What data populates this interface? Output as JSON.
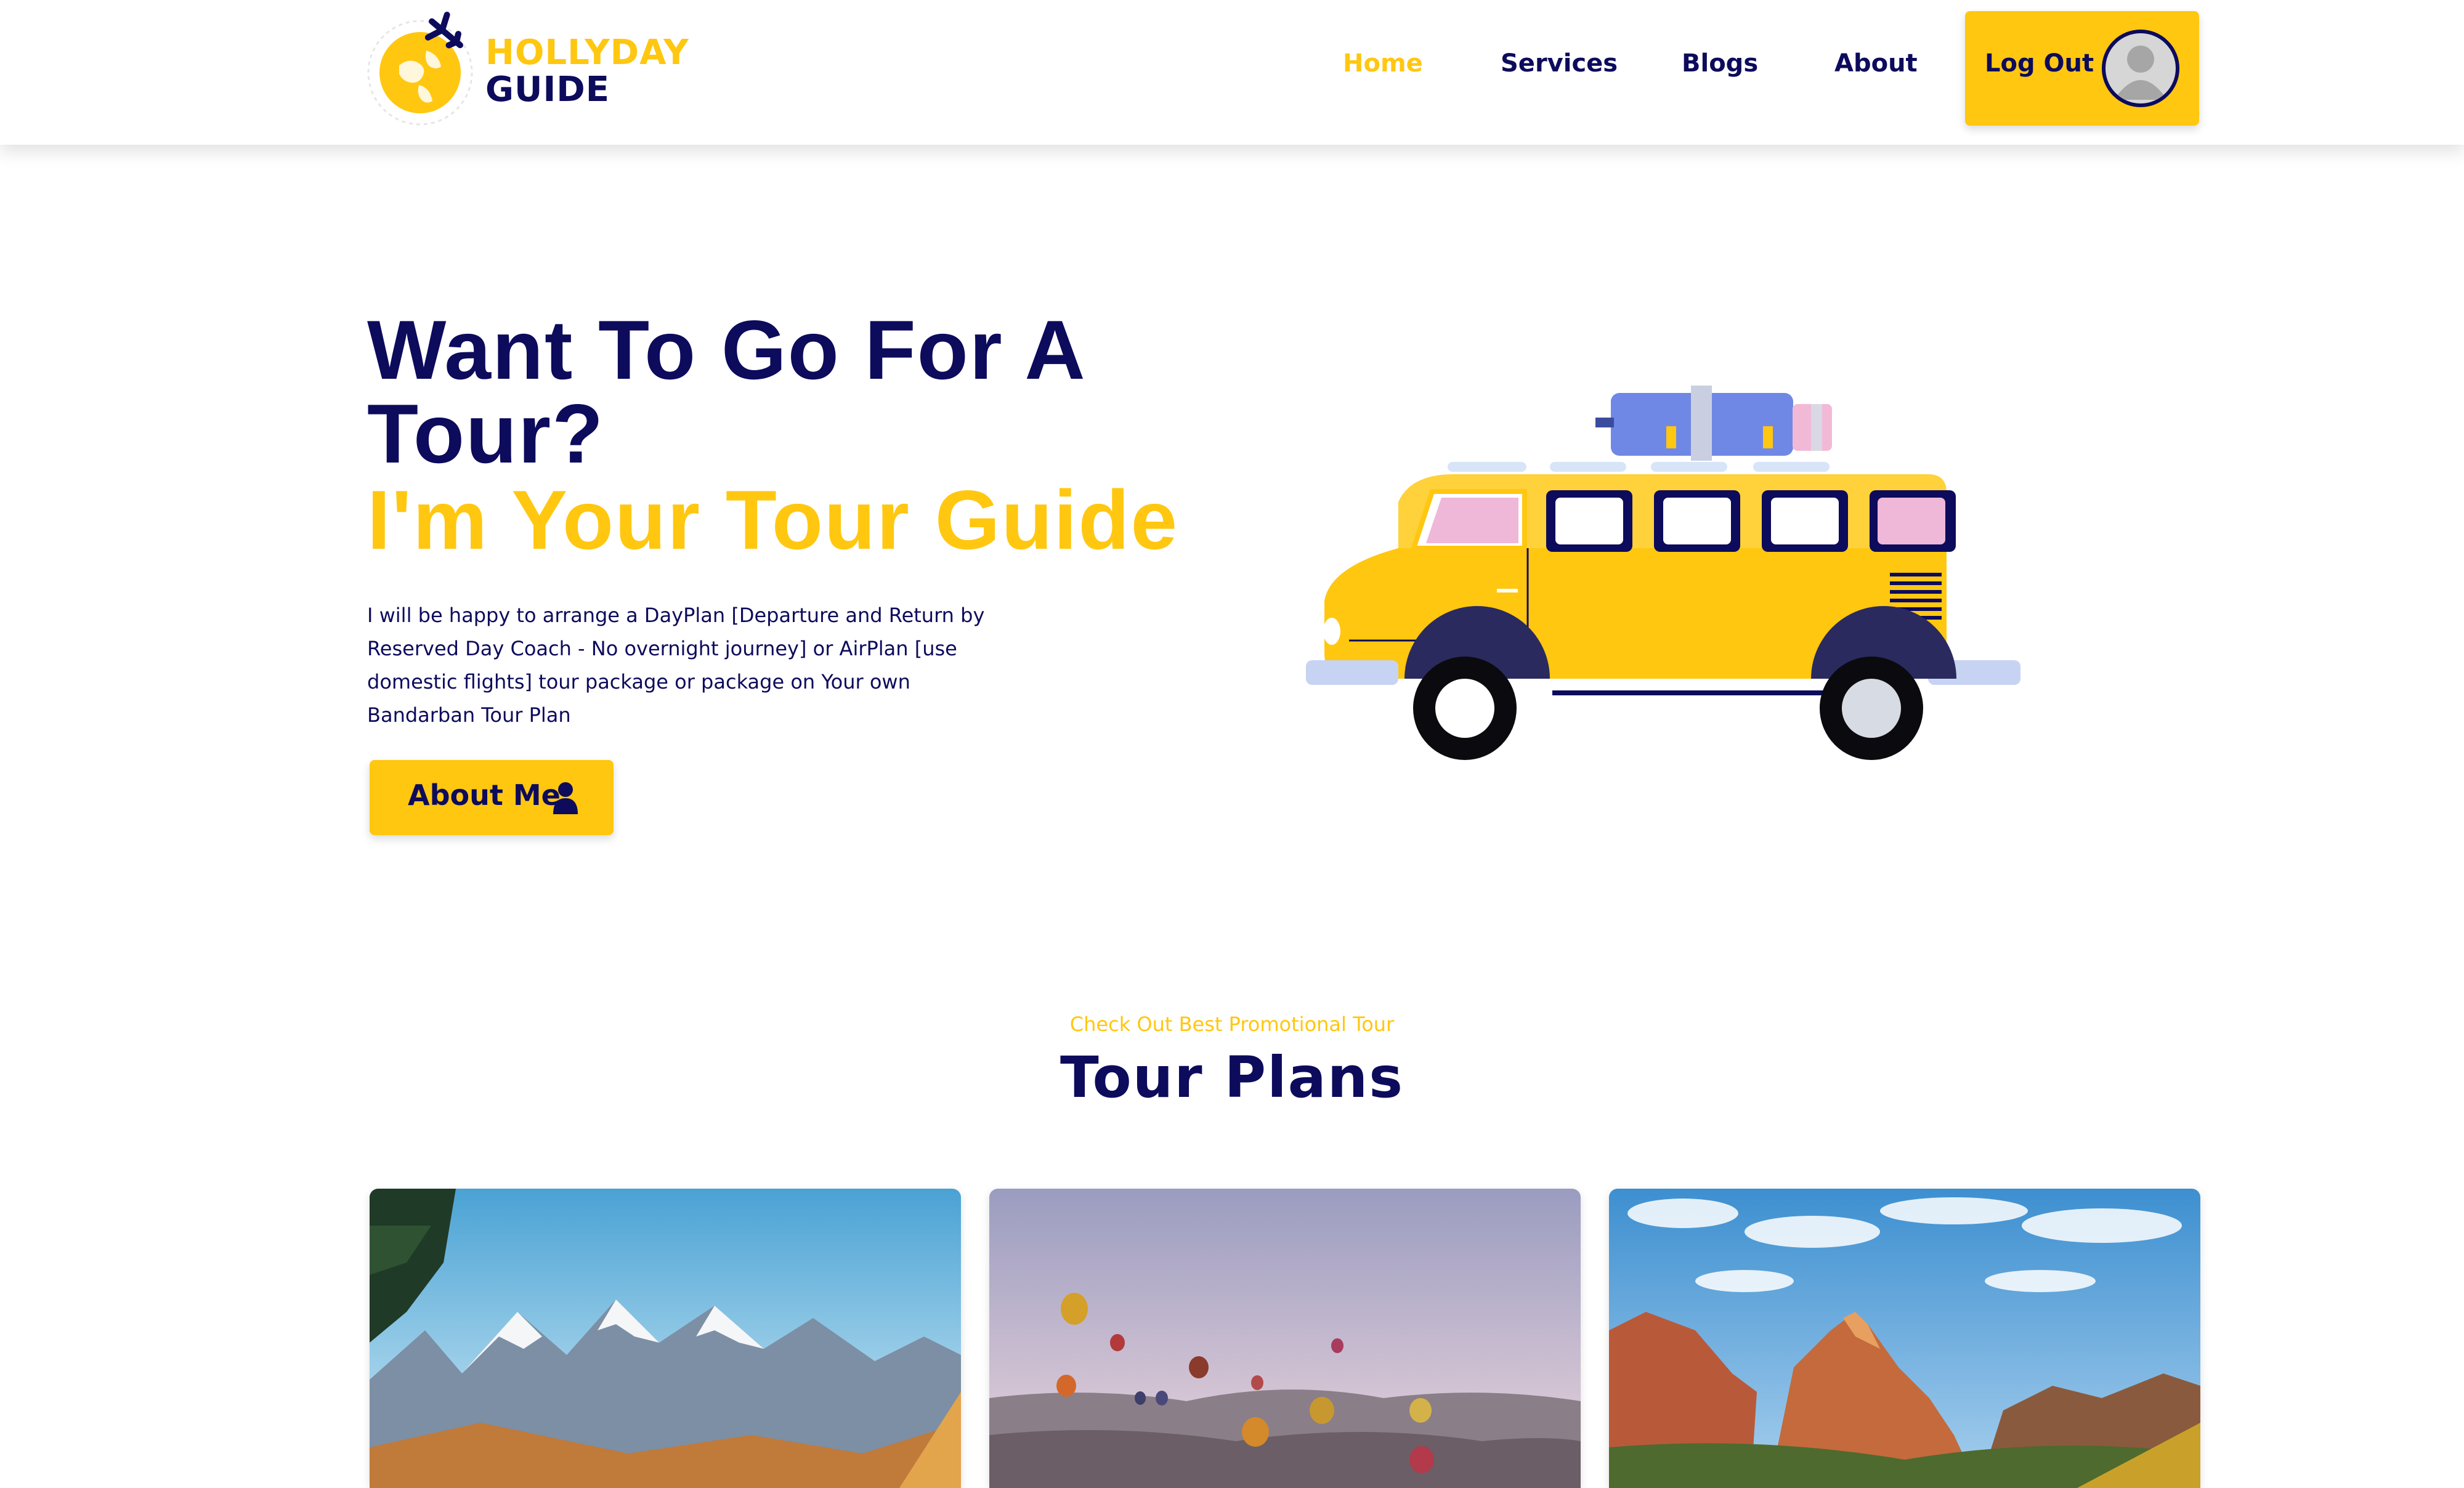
{
  "brand": {
    "line1": "HOLLYDAY",
    "line2": "GUIDE",
    "icon": "globe-plane-icon"
  },
  "nav": {
    "items": [
      {
        "label": "Home",
        "active": true
      },
      {
        "label": "Services",
        "active": false
      },
      {
        "label": "Blogs",
        "active": false
      },
      {
        "label": "About",
        "active": false
      }
    ],
    "logout_label": "Log Out",
    "avatar_icon": "user-avatar-icon"
  },
  "hero": {
    "title_line1": "Want To Go For A",
    "title_line2": "Tour?",
    "title_line3": "I'm Your Tour Guide",
    "description": "I will be happy to arrange a DayPlan [Departure and Return by Reserved Day Coach - No overnight journey] or AirPlan [use domestic flights] tour package or package on Your own Bandarban Tour Plan",
    "about_button": "About Me",
    "about_icon": "user-icon",
    "illustration": "van-icon"
  },
  "tours": {
    "kicker": "Check Out Best Promotional Tour",
    "title": "Tour Plans",
    "cards": [
      {
        "image": "snowy-mountains-image"
      },
      {
        "image": "hot-air-balloons-image"
      },
      {
        "image": "canyon-valley-image"
      }
    ]
  },
  "colors": {
    "accent": "#ffc710",
    "navy": "#0d0b5c",
    "background": "#ffffff"
  }
}
